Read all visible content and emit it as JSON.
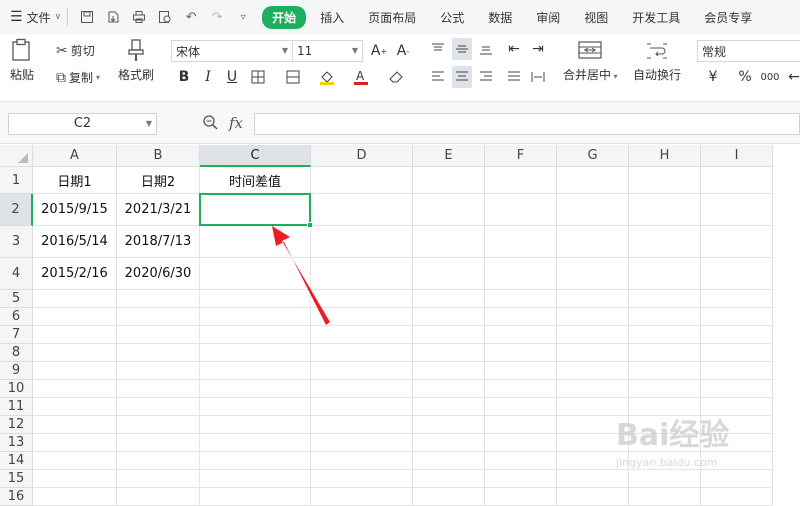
{
  "menubar": {
    "file_label": "文件",
    "tabs": [
      "开始",
      "插入",
      "页面布局",
      "公式",
      "数据",
      "审阅",
      "视图",
      "开发工具",
      "会员专享"
    ]
  },
  "ribbon": {
    "paste": "粘贴",
    "cut": "剪切",
    "copy": "复制",
    "format_painter": "格式刷",
    "font_name": "宋体",
    "font_size": "11",
    "merge_center": "合并居中",
    "wrap_text": "自动换行",
    "number_format": "常规",
    "currency_symbol": "¥",
    "percent_symbol": "%",
    "thousands_symbol": "000"
  },
  "formula_bar": {
    "name_box": "C2",
    "fx_label": "fx",
    "formula": ""
  },
  "sheet": {
    "columns": [
      "A",
      "B",
      "C",
      "D",
      "E",
      "F",
      "G",
      "H",
      "I"
    ],
    "rows": [
      "1",
      "2",
      "3",
      "4",
      "5",
      "6",
      "7",
      "8",
      "9",
      "10",
      "11",
      "12",
      "13",
      "14",
      "15",
      "16"
    ],
    "header_row": [
      "日期1",
      "日期2",
      "时间差值"
    ],
    "data": [
      [
        "2015/9/15",
        "2021/3/21",
        ""
      ],
      [
        "2016/5/14",
        "2018/7/13",
        ""
      ],
      [
        "2015/2/16",
        "2020/6/30",
        ""
      ]
    ],
    "selected_cell": "C2"
  },
  "colors": {
    "accent": "#1fae5e",
    "arrow": "#ee1c25"
  },
  "watermark": {
    "main": "Bai经验",
    "sub": "jingyan.baidu.com"
  }
}
